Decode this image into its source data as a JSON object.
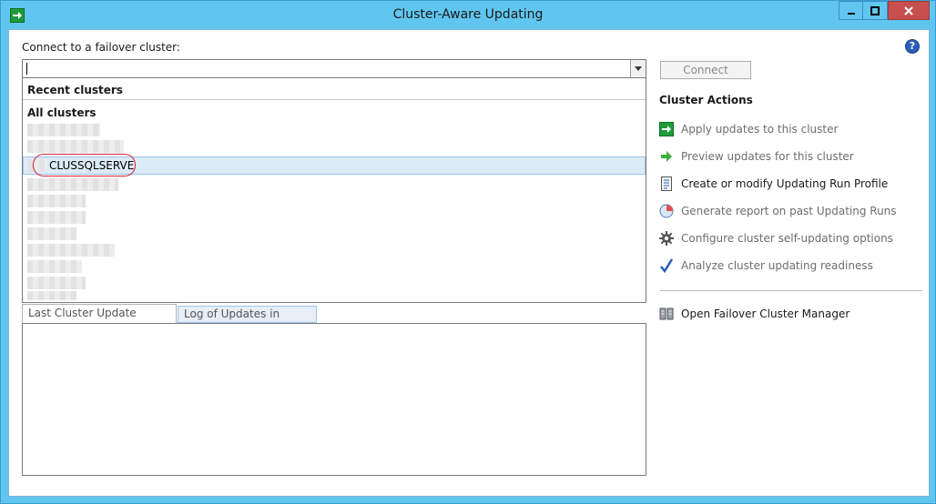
{
  "window": {
    "title": "Cluster-Aware Updating",
    "caption_close_color": "#c7504f",
    "frame_color": "#60c6f0"
  },
  "connect": {
    "label": "Connect to a failover cluster:",
    "input_value": "",
    "button_label": "Connect"
  },
  "dropdown": {
    "recent_header": "Recent clusters",
    "all_header": "All clusters",
    "selected_item": "CLUSSQLSERVE"
  },
  "actions": {
    "title": "Cluster Actions",
    "items": [
      {
        "label": "Apply updates to this cluster",
        "icon": "apply-updates-icon"
      },
      {
        "label": "Preview updates for this cluster",
        "icon": "preview-arrow-icon"
      },
      {
        "label": "Create or modify Updating Run Profile",
        "icon": "profile-document-icon"
      },
      {
        "label": "Generate report on past Updating Runs",
        "icon": "report-chart-icon"
      },
      {
        "label": "Configure cluster self-updating options",
        "icon": "gear-icon"
      },
      {
        "label": "Analyze cluster updating readiness",
        "icon": "checkmark-icon"
      }
    ],
    "open_manager": "Open Failover Cluster Manager"
  },
  "tabs": [
    {
      "label": "Last Cluster Update Summary"
    },
    {
      "label": "Log of Updates in Progress"
    }
  ]
}
